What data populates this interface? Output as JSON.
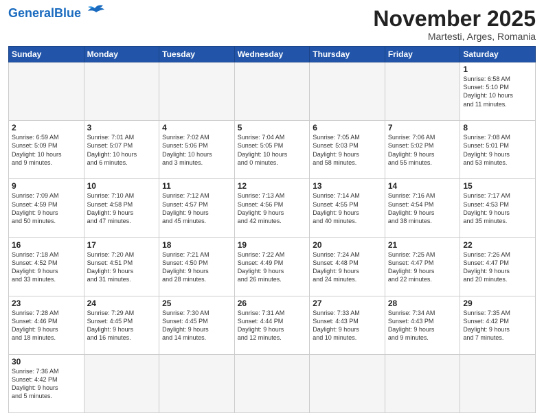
{
  "header": {
    "logo_general": "General",
    "logo_blue": "Blue",
    "month": "November 2025",
    "location": "Martesti, Arges, Romania"
  },
  "weekdays": [
    "Sunday",
    "Monday",
    "Tuesday",
    "Wednesday",
    "Thursday",
    "Friday",
    "Saturday"
  ],
  "weeks": [
    [
      {
        "day": "",
        "info": ""
      },
      {
        "day": "",
        "info": ""
      },
      {
        "day": "",
        "info": ""
      },
      {
        "day": "",
        "info": ""
      },
      {
        "day": "",
        "info": ""
      },
      {
        "day": "",
        "info": ""
      },
      {
        "day": "1",
        "info": "Sunrise: 6:58 AM\nSunset: 5:10 PM\nDaylight: 10 hours\nand 11 minutes."
      }
    ],
    [
      {
        "day": "2",
        "info": "Sunrise: 6:59 AM\nSunset: 5:09 PM\nDaylight: 10 hours\nand 9 minutes."
      },
      {
        "day": "3",
        "info": "Sunrise: 7:01 AM\nSunset: 5:07 PM\nDaylight: 10 hours\nand 6 minutes."
      },
      {
        "day": "4",
        "info": "Sunrise: 7:02 AM\nSunset: 5:06 PM\nDaylight: 10 hours\nand 3 minutes."
      },
      {
        "day": "5",
        "info": "Sunrise: 7:04 AM\nSunset: 5:05 PM\nDaylight: 10 hours\nand 0 minutes."
      },
      {
        "day": "6",
        "info": "Sunrise: 7:05 AM\nSunset: 5:03 PM\nDaylight: 9 hours\nand 58 minutes."
      },
      {
        "day": "7",
        "info": "Sunrise: 7:06 AM\nSunset: 5:02 PM\nDaylight: 9 hours\nand 55 minutes."
      },
      {
        "day": "8",
        "info": "Sunrise: 7:08 AM\nSunset: 5:01 PM\nDaylight: 9 hours\nand 53 minutes."
      }
    ],
    [
      {
        "day": "9",
        "info": "Sunrise: 7:09 AM\nSunset: 4:59 PM\nDaylight: 9 hours\nand 50 minutes."
      },
      {
        "day": "10",
        "info": "Sunrise: 7:10 AM\nSunset: 4:58 PM\nDaylight: 9 hours\nand 47 minutes."
      },
      {
        "day": "11",
        "info": "Sunrise: 7:12 AM\nSunset: 4:57 PM\nDaylight: 9 hours\nand 45 minutes."
      },
      {
        "day": "12",
        "info": "Sunrise: 7:13 AM\nSunset: 4:56 PM\nDaylight: 9 hours\nand 42 minutes."
      },
      {
        "day": "13",
        "info": "Sunrise: 7:14 AM\nSunset: 4:55 PM\nDaylight: 9 hours\nand 40 minutes."
      },
      {
        "day": "14",
        "info": "Sunrise: 7:16 AM\nSunset: 4:54 PM\nDaylight: 9 hours\nand 38 minutes."
      },
      {
        "day": "15",
        "info": "Sunrise: 7:17 AM\nSunset: 4:53 PM\nDaylight: 9 hours\nand 35 minutes."
      }
    ],
    [
      {
        "day": "16",
        "info": "Sunrise: 7:18 AM\nSunset: 4:52 PM\nDaylight: 9 hours\nand 33 minutes."
      },
      {
        "day": "17",
        "info": "Sunrise: 7:20 AM\nSunset: 4:51 PM\nDaylight: 9 hours\nand 31 minutes."
      },
      {
        "day": "18",
        "info": "Sunrise: 7:21 AM\nSunset: 4:50 PM\nDaylight: 9 hours\nand 28 minutes."
      },
      {
        "day": "19",
        "info": "Sunrise: 7:22 AM\nSunset: 4:49 PM\nDaylight: 9 hours\nand 26 minutes."
      },
      {
        "day": "20",
        "info": "Sunrise: 7:24 AM\nSunset: 4:48 PM\nDaylight: 9 hours\nand 24 minutes."
      },
      {
        "day": "21",
        "info": "Sunrise: 7:25 AM\nSunset: 4:47 PM\nDaylight: 9 hours\nand 22 minutes."
      },
      {
        "day": "22",
        "info": "Sunrise: 7:26 AM\nSunset: 4:47 PM\nDaylight: 9 hours\nand 20 minutes."
      }
    ],
    [
      {
        "day": "23",
        "info": "Sunrise: 7:28 AM\nSunset: 4:46 PM\nDaylight: 9 hours\nand 18 minutes."
      },
      {
        "day": "24",
        "info": "Sunrise: 7:29 AM\nSunset: 4:45 PM\nDaylight: 9 hours\nand 16 minutes."
      },
      {
        "day": "25",
        "info": "Sunrise: 7:30 AM\nSunset: 4:45 PM\nDaylight: 9 hours\nand 14 minutes."
      },
      {
        "day": "26",
        "info": "Sunrise: 7:31 AM\nSunset: 4:44 PM\nDaylight: 9 hours\nand 12 minutes."
      },
      {
        "day": "27",
        "info": "Sunrise: 7:33 AM\nSunset: 4:43 PM\nDaylight: 9 hours\nand 10 minutes."
      },
      {
        "day": "28",
        "info": "Sunrise: 7:34 AM\nSunset: 4:43 PM\nDaylight: 9 hours\nand 9 minutes."
      },
      {
        "day": "29",
        "info": "Sunrise: 7:35 AM\nSunset: 4:42 PM\nDaylight: 9 hours\nand 7 minutes."
      }
    ],
    [
      {
        "day": "30",
        "info": "Sunrise: 7:36 AM\nSunset: 4:42 PM\nDaylight: 9 hours\nand 5 minutes."
      },
      {
        "day": "",
        "info": ""
      },
      {
        "day": "",
        "info": ""
      },
      {
        "day": "",
        "info": ""
      },
      {
        "day": "",
        "info": ""
      },
      {
        "day": "",
        "info": ""
      },
      {
        "day": "",
        "info": ""
      }
    ]
  ]
}
